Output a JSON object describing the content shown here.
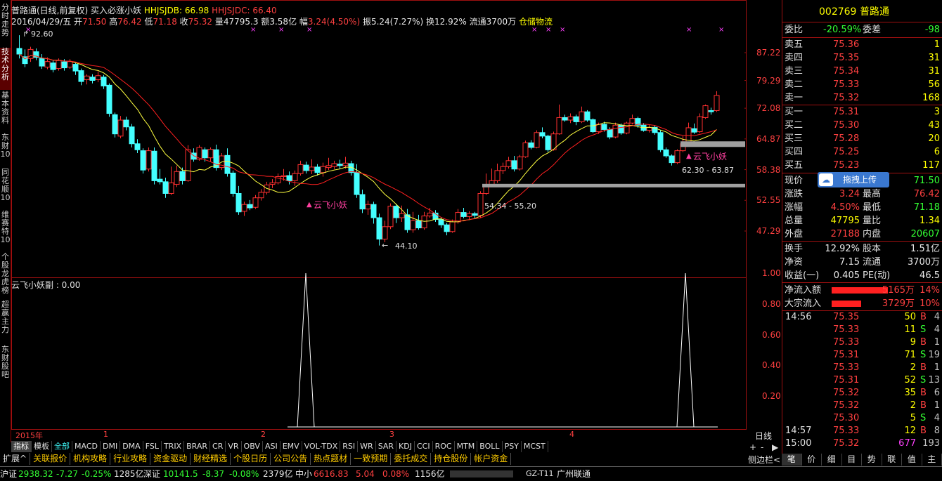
{
  "left_tabs": [
    {
      "label": "分时走势",
      "active": false
    },
    {
      "label": "技术分析",
      "active": true
    },
    {
      "label": "基本资料",
      "active": false
    },
    {
      "label": "东财10",
      "active": false
    },
    {
      "label": "同花顺10",
      "active": false
    },
    {
      "label": "维赛特10",
      "active": false
    },
    {
      "label": "个股龙虎榜",
      "active": false
    },
    {
      "label": "超赢主力",
      "active": false
    },
    {
      "label": "东财股吧",
      "active": false
    }
  ],
  "info": {
    "line1_name": "普路通(日线,前复权) 买入必涨小妖",
    "line1_hhjsjdb": "HHJSJDB: 66.98",
    "line1_hhjsjdc": "HHJSJDC: 66.40",
    "date": "2016/04/29/五",
    "open_label": "开",
    "open": "71.50",
    "high_label": "高",
    "high": "76.42",
    "low_label": "低",
    "low": "71.18",
    "close_label": "收",
    "close": "75.32",
    "vol_label": "量",
    "vol": "47795.3",
    "amount_label": "额",
    "amount": "3.58亿",
    "change_label": "幅",
    "change": "3.24(4.50%)",
    "swing": "振5.24(7.27%)",
    "turnover": "换12.92%",
    "float": "流通3700万",
    "sector": "仓储物流"
  },
  "price_axis": [
    "87.22",
    "79.29",
    "72.08",
    "64.87",
    "58.38",
    "52.55",
    "47.29"
  ],
  "sub_axis": [
    "1.00",
    "0.80",
    "0.60",
    "0.40",
    "0.20"
  ],
  "sub_title": "云飞小妖副 : 0.00",
  "annotations": {
    "high_mark": "92.60",
    "low_mark": "44.10",
    "zone1": "54.34 - 55.20",
    "zone2": "62.30 - 63.87",
    "signal1": "云飞小妖",
    "signal2": "云飞小妖"
  },
  "time_axis": [
    {
      "label": "2015年"
    },
    {
      "label": "1"
    },
    {
      "label": "2"
    },
    {
      "label": "3"
    },
    {
      "label": "4"
    }
  ],
  "period_label": "日线",
  "zoom_controls": [
    "+",
    "-",
    "▶"
  ],
  "sidebar_toggle": "侧边栏<",
  "indicators": [
    "指标",
    "模板",
    "全部",
    "MACD",
    "DMI",
    "DMA",
    "FSL",
    "TRIX",
    "BRAR",
    "CR",
    "VR",
    "OBV",
    "ASI",
    "EMV",
    "VOL-TDX",
    "RSI",
    "WR",
    "SAR",
    "KDJ",
    "CCI",
    "ROC",
    "MTM",
    "BOLL",
    "PSY",
    "MCST"
  ],
  "func_bar": [
    "扩展^",
    "关联报价",
    "机构攻略",
    "行业攻略",
    "资金驱动",
    "财经精选",
    "个股日历",
    "公司公告",
    "热点题材",
    "一致预期",
    "委托成交",
    "持仓股份",
    "帐户资金"
  ],
  "status": {
    "sh_label": "沪证",
    "sh_index": "2938.32",
    "sh_chg": "-7.27",
    "sh_pct": "-0.25%",
    "sh_amt": "1285亿",
    "sz_label": "深证",
    "sz_index": "10141.5",
    "sz_chg": "-8.37",
    "sz_pct": "-0.08%",
    "sz_amt": "2379亿",
    "zx_label": "中小",
    "zx_index": "6616.83",
    "zx_chg": "5.04",
    "zx_pct": "0.08%",
    "zx_amt": "1156亿",
    "server": "GZ-T11",
    "broker": "广州联通"
  },
  "quote": {
    "code": "002769",
    "name": "普路通",
    "weibi_label": "委比",
    "weibi": "-20.59%",
    "weicha_label": "委差",
    "weicha": "-98",
    "sells": [
      {
        "label": "卖五",
        "price": "75.36",
        "vol": "1"
      },
      {
        "label": "卖四",
        "price": "75.35",
        "vol": "31"
      },
      {
        "label": "卖三",
        "price": "75.34",
        "vol": "31"
      },
      {
        "label": "卖二",
        "price": "75.33",
        "vol": "56"
      },
      {
        "label": "卖一",
        "price": "75.32",
        "vol": "168"
      }
    ],
    "buys": [
      {
        "label": "买一",
        "price": "75.31",
        "vol": "3"
      },
      {
        "label": "买二",
        "price": "75.30",
        "vol": "43"
      },
      {
        "label": "买三",
        "price": "75.28",
        "vol": "20"
      },
      {
        "label": "买四",
        "price": "75.25",
        "vol": "6"
      },
      {
        "label": "买五",
        "price": "75.23",
        "vol": "117"
      }
    ],
    "upload_label": "拖拽上传",
    "stats": [
      {
        "l1": "现价",
        "v1": "",
        "l2": "",
        "v2": "71.50"
      },
      {
        "l1": "涨跌",
        "v1": "3.24",
        "l2": "最高",
        "v2": "76.42"
      },
      {
        "l1": "涨幅",
        "v1": "4.50%",
        "l2": "最低",
        "v2": "71.18"
      },
      {
        "l1": "总量",
        "v1": "47795",
        "l2": "量比",
        "v2": "1.34"
      },
      {
        "l1": "外盘",
        "v1": "27188",
        "l2": "内盘",
        "v2": "20607"
      }
    ],
    "stats2": [
      {
        "l1": "换手",
        "v1": "12.92%",
        "l2": "股本",
        "v2": "1.51亿"
      },
      {
        "l1": "净资",
        "v1": "7.15",
        "l2": "流通",
        "v2": "3700万"
      },
      {
        "l1": "收益(一)",
        "v1": "0.405",
        "l2": "PE(动)",
        "v2": "46.5"
      }
    ],
    "flow": [
      {
        "label": "净流入额",
        "amt": "5165万",
        "pct": "14%"
      },
      {
        "label": "大宗流入",
        "amt": "3729万",
        "pct": "10%"
      }
    ],
    "ticks": [
      {
        "t": "14:56",
        "p": "75.35",
        "v": "50",
        "bs": "B",
        "n": "4"
      },
      {
        "t": "",
        "p": "75.33",
        "v": "11",
        "bs": "S",
        "n": "4"
      },
      {
        "t": "",
        "p": "75.33",
        "v": "9",
        "bs": "B",
        "n": "1"
      },
      {
        "t": "",
        "p": "75.31",
        "v": "71",
        "bs": "S",
        "n": "19"
      },
      {
        "t": "",
        "p": "75.33",
        "v": "2",
        "bs": "B",
        "n": "1"
      },
      {
        "t": "",
        "p": "75.31",
        "v": "52",
        "bs": "S",
        "n": "13"
      },
      {
        "t": "",
        "p": "75.32",
        "v": "35",
        "bs": "B",
        "n": "6"
      },
      {
        "t": "",
        "p": "75.32",
        "v": "2",
        "bs": "B",
        "n": "1"
      },
      {
        "t": "",
        "p": "75.30",
        "v": "5",
        "bs": "S",
        "n": "4"
      },
      {
        "t": "14:57",
        "p": "75.33",
        "v": "12",
        "bs": "B",
        "n": "8"
      },
      {
        "t": "15:00",
        "p": "75.32",
        "v": "677",
        "bs": "",
        "n": "193"
      }
    ],
    "tabs": [
      "笔",
      "价",
      "细",
      "目",
      "势",
      "联",
      "值",
      "主"
    ]
  }
}
